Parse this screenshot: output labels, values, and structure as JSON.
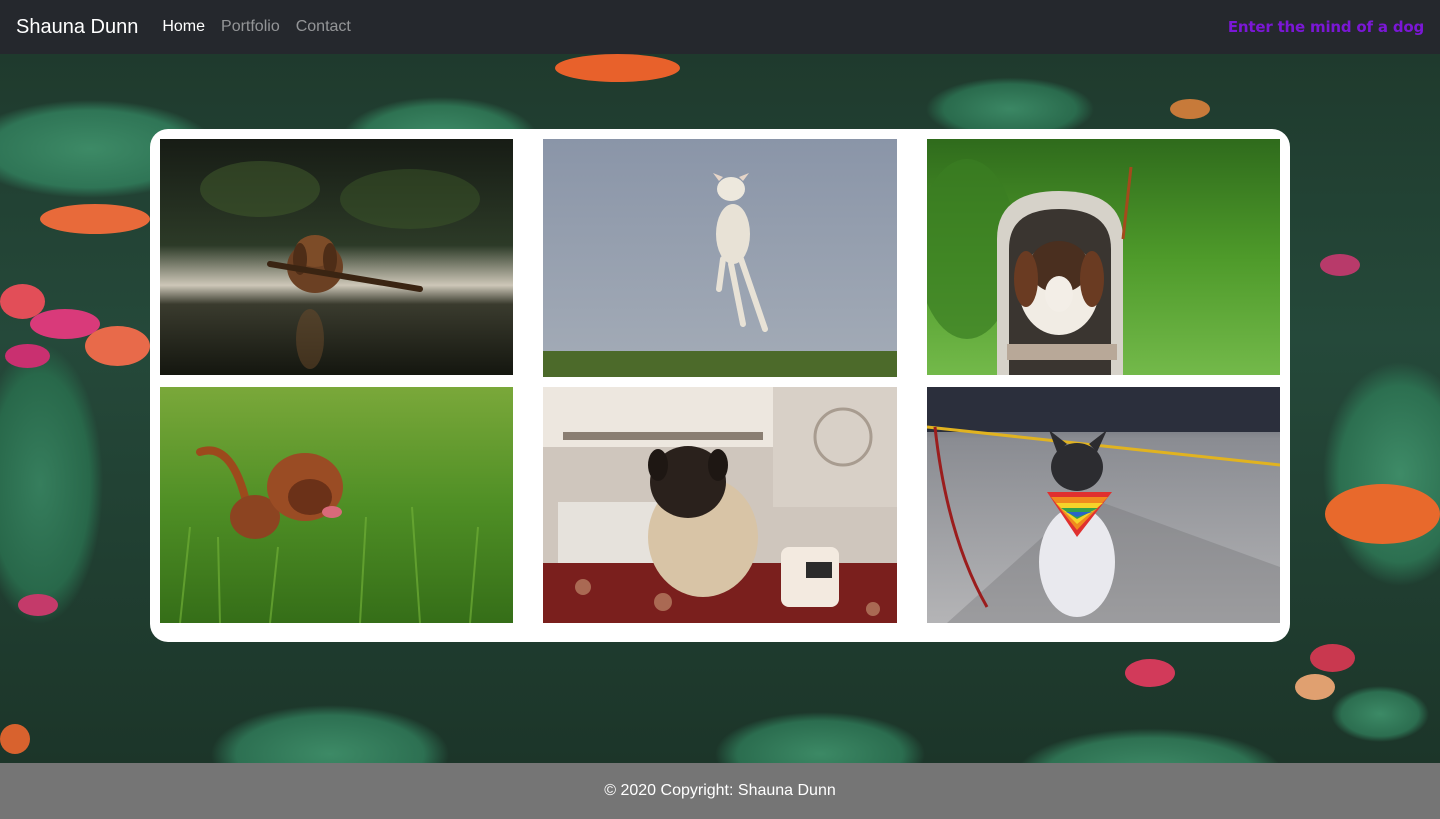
{
  "navbar": {
    "brand": "Shauna Dunn",
    "links": [
      {
        "label": "Home",
        "active": true
      },
      {
        "label": "Portfolio",
        "active": false
      },
      {
        "label": "Contact",
        "active": false
      }
    ],
    "tagline": "Enter the mind of a dog",
    "tagline_color": "#7b17d6"
  },
  "hero": {
    "background": "cactus-field-photo"
  },
  "gallery": {
    "photos": [
      {
        "subject": "dog-swimming-with-stick-photo"
      },
      {
        "subject": "dog-jumping-in-air-photo"
      },
      {
        "subject": "dog-in-mailbox-photo"
      },
      {
        "subject": "dog-in-tall-grass-photo"
      },
      {
        "subject": "pug-at-table-photo"
      },
      {
        "subject": "dog-with-rainbow-bandana-photo"
      }
    ]
  },
  "footer": {
    "copyright": "© 2020 Copyright: Shauna Dunn"
  }
}
